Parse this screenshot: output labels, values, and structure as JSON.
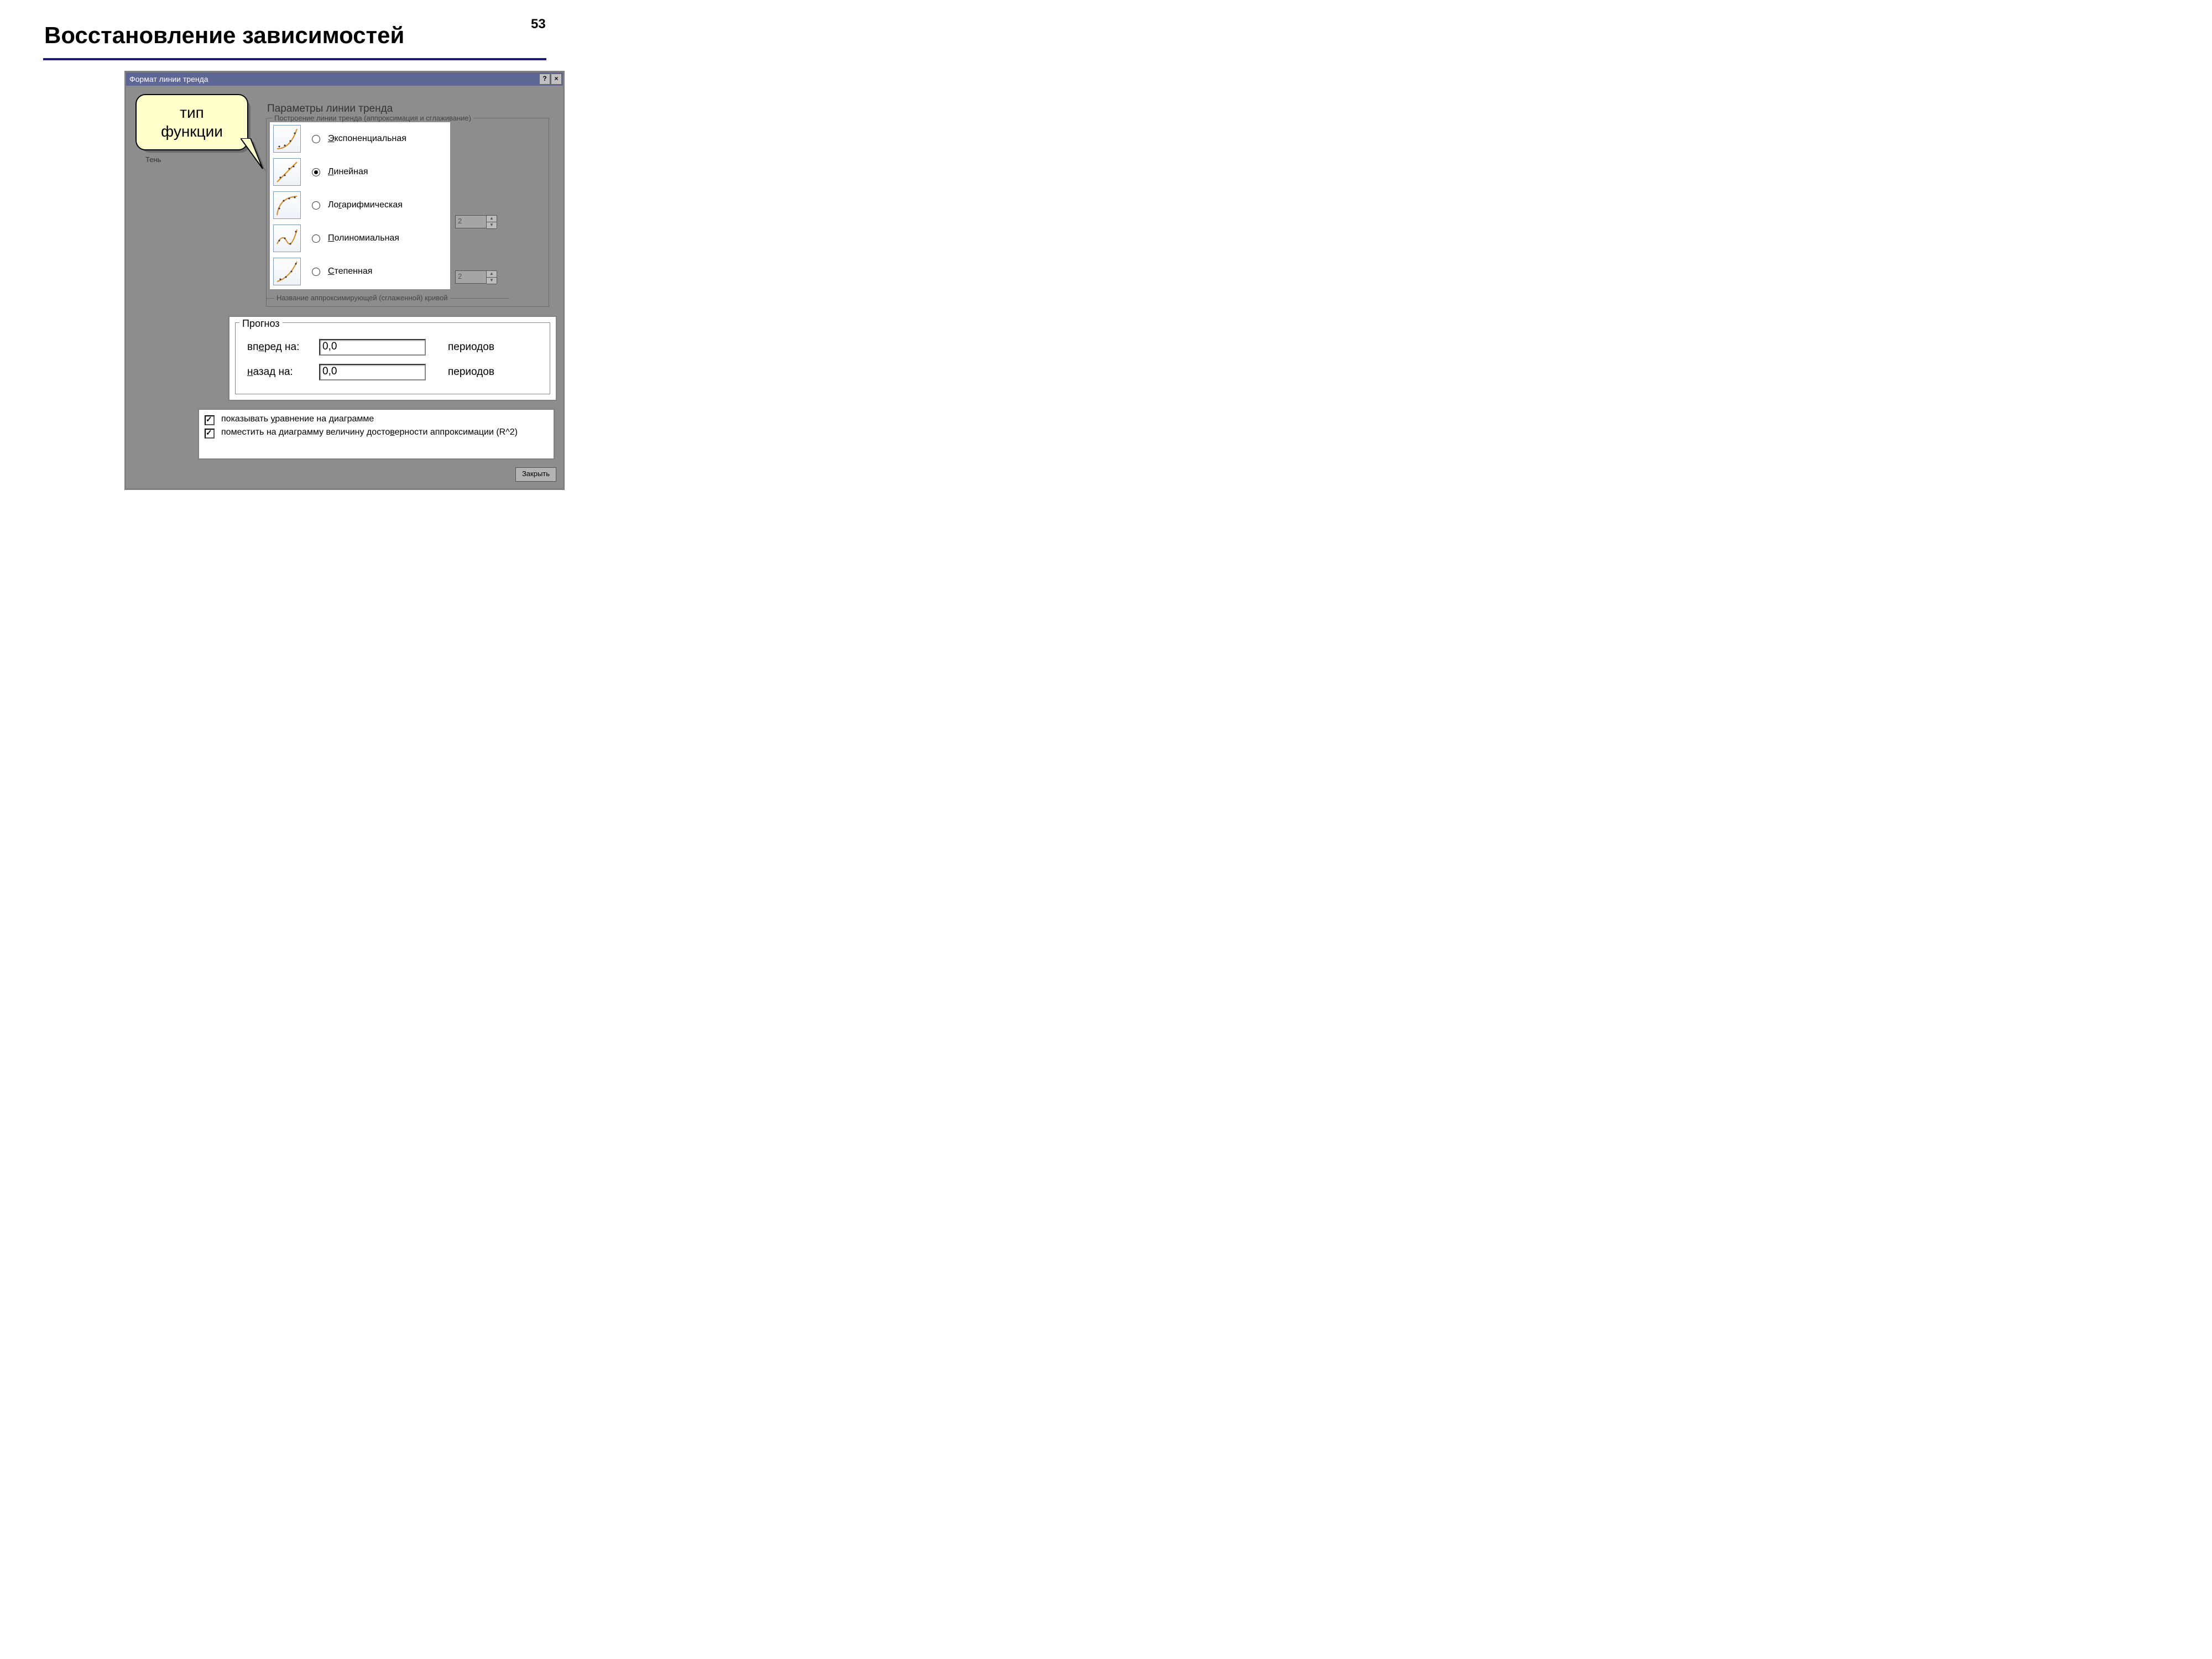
{
  "slide": {
    "title": "Восстановление зависимостей",
    "page": "53"
  },
  "callout": {
    "line1": "тип",
    "line2": "функции"
  },
  "dialog": {
    "title": "Формат линии тренда",
    "help": "?",
    "close_icon": "×",
    "sidebar_remnant": "Тень",
    "params_title": "Параметры линии тренда",
    "group1_legend": "Построение линии тренда (аппроксимация и сглаживание)",
    "trends": {
      "exp": "Экспоненциальная",
      "lin": "Линейная",
      "log": "Логарифмическая",
      "poly": "Полиномиальная",
      "pow": "Степенная"
    },
    "spinner_value": "2",
    "group_name_legend": "Название аппроксимирующей (сглаженной) кривой",
    "forecast": {
      "legend": "Прогноз",
      "forward_label": "вперед на:",
      "back_label": "назад на:",
      "forward_value": "0,0",
      "back_value": "0,0",
      "unit": "периодов"
    },
    "checks": {
      "eq": "показывать уравнение на диаграмме",
      "r2": "поместить на диаграмму величину достоверности аппроксимации (R^2)"
    },
    "close_button": "Закрыть"
  }
}
